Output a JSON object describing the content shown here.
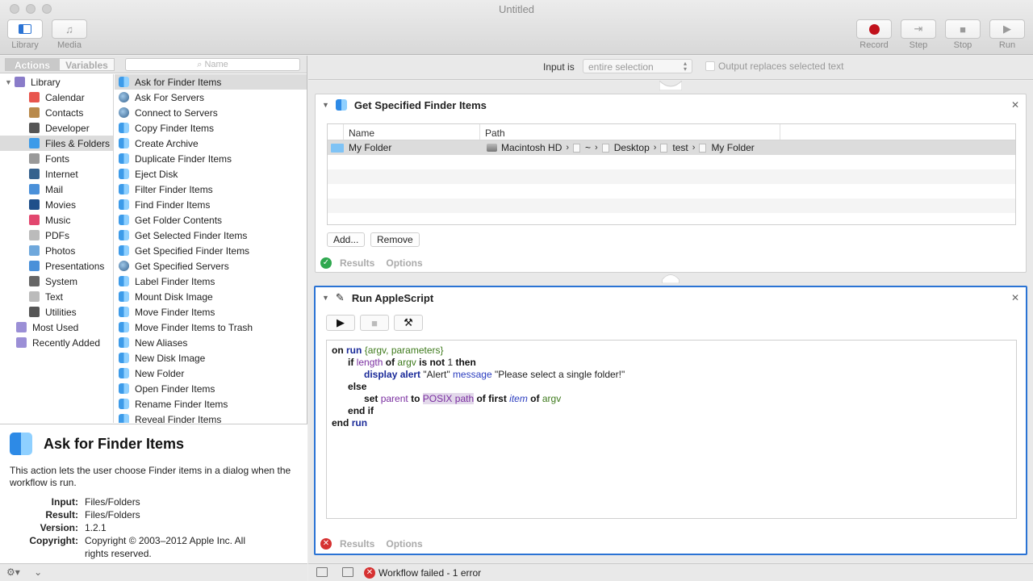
{
  "window": {
    "title": "Untitled"
  },
  "toolbar": {
    "library_label": "Library",
    "media_label": "Media",
    "record_label": "Record",
    "step_label": "Step",
    "stop_label": "Stop",
    "run_label": "Run",
    "record_color": "#c1111b"
  },
  "tabs": {
    "actions": "Actions",
    "variables": "Variables"
  },
  "search": {
    "placeholder": "Name"
  },
  "library": {
    "root": "Library",
    "items": [
      {
        "label": "Calendar",
        "icon": "calendar-icon",
        "color": "#e8554d"
      },
      {
        "label": "Contacts",
        "icon": "contacts-icon",
        "color": "#b98a4b"
      },
      {
        "label": "Developer",
        "icon": "developer-icon",
        "color": "#555555"
      },
      {
        "label": "Files & Folders",
        "icon": "finder-icon",
        "color": "#3d9be9"
      },
      {
        "label": "Fonts",
        "icon": "fonts-icon",
        "color": "#999999"
      },
      {
        "label": "Internet",
        "icon": "internet-icon",
        "color": "#35628e"
      },
      {
        "label": "Mail",
        "icon": "mail-icon",
        "color": "#4a90d9"
      },
      {
        "label": "Movies",
        "icon": "movies-icon",
        "color": "#1f4f8a"
      },
      {
        "label": "Music",
        "icon": "music-icon",
        "color": "#e2476f"
      },
      {
        "label": "PDFs",
        "icon": "pdfs-icon",
        "color": "#bbbbbb"
      },
      {
        "label": "Photos",
        "icon": "photos-icon",
        "color": "#6fa8dc"
      },
      {
        "label": "Presentations",
        "icon": "presentations-icon",
        "color": "#4a90d9"
      },
      {
        "label": "System",
        "icon": "system-icon",
        "color": "#666666"
      },
      {
        "label": "Text",
        "icon": "text-icon",
        "color": "#bbbbbb"
      },
      {
        "label": "Utilities",
        "icon": "utilities-icon",
        "color": "#555555"
      }
    ],
    "most_used": "Most Used",
    "recently_added": "Recently Added"
  },
  "actions": [
    "Ask for Finder Items",
    "Ask For Servers",
    "Connect to Servers",
    "Copy Finder Items",
    "Create Archive",
    "Duplicate Finder Items",
    "Eject Disk",
    "Filter Finder Items",
    "Find Finder Items",
    "Get Folder Contents",
    "Get Selected Finder Items",
    "Get Specified Finder Items",
    "Get Specified Servers",
    "Label Finder Items",
    "Mount Disk Image",
    "Move Finder Items",
    "Move Finder Items to Trash",
    "New Aliases",
    "New Disk Image",
    "New Folder",
    "Open Finder Items",
    "Rename Finder Items",
    "Reveal Finder Items"
  ],
  "description": {
    "title": "Ask for Finder Items",
    "text": "This action lets the user choose Finder items in a dialog when the workflow is run.",
    "input_label": "Input:",
    "input": "Files/Folders",
    "result_label": "Result:",
    "result": "Files/Folders",
    "version_label": "Version:",
    "version": "1.2.1",
    "copyright_label": "Copyright:",
    "copyright": "Copyright © 2003–2012 Apple Inc.  All rights reserved."
  },
  "input_bar": {
    "label": "Input is",
    "value": "entire selection",
    "checkbox_label": "Output replaces selected text"
  },
  "action1": {
    "title": "Get Specified Finder Items",
    "col_name": "Name",
    "col_path": "Path",
    "row_name": "My Folder",
    "path": [
      "Macintosh HD",
      "~",
      "Desktop",
      "test",
      "My Folder"
    ],
    "add_label": "Add...",
    "remove_label": "Remove",
    "results_label": "Results",
    "options_label": "Options",
    "status_color": "#2fa84f"
  },
  "action2": {
    "title": "Run AppleScript",
    "results_label": "Results",
    "options_label": "Options",
    "status_color": "#d63131",
    "code": {
      "l1_on": "on",
      "l1_run": "run",
      "l1_args": "{argv, parameters}",
      "l2_if": "if",
      "l2_length": "length",
      "l2_of": "of",
      "l2_argv": "argv",
      "l2_isnot": "is not",
      "l2_num": "1",
      "l2_then": "then",
      "l3_display": "display alert",
      "l3_alert": "\"Alert\"",
      "l3_message": "message",
      "l3_msg": "\"Please select a single folder!\"",
      "l4_else": "else",
      "l5_set": "set",
      "l5_parent": "parent",
      "l5_to": "to",
      "l5_posix": "POSIX path",
      "l5_of": "of",
      "l5_first": "first",
      "l5_item": "item",
      "l5_of2": "of",
      "l5_argv": "argv",
      "l6_endif": "end if",
      "l7_end": "end",
      "l7_run": "run"
    }
  },
  "status": {
    "message": "Workflow failed - 1 error"
  }
}
